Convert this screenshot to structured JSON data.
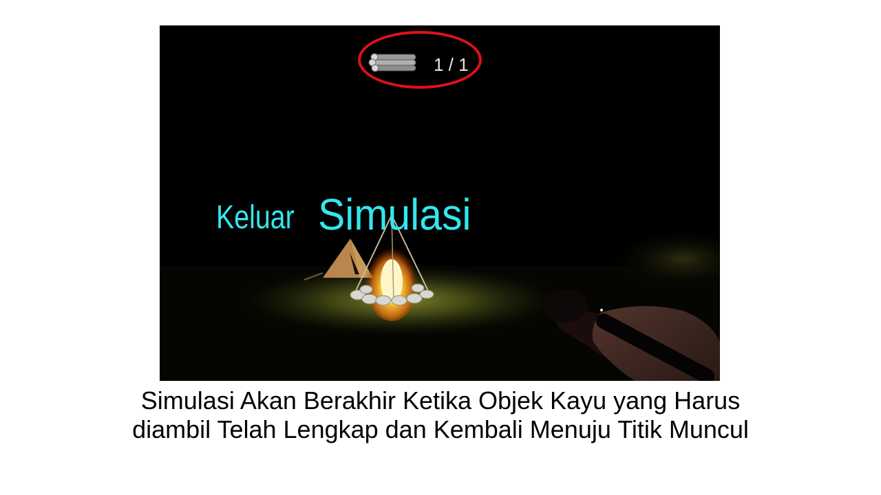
{
  "hud": {
    "item_icon": "wood-log-icon",
    "collected_count": "1 / 1",
    "highlight_color": "#e0101a"
  },
  "scene": {
    "exit_text_word1": "Keluar",
    "exit_text_word2": "Simulasi",
    "exit_text_color": "#33e6ee"
  },
  "caption": {
    "line1": "Simulasi Akan Berakhir Ketika Objek Kayu yang Harus",
    "line2": "diambil Telah Lengkap dan Kembali Menuju Titik Muncul"
  }
}
